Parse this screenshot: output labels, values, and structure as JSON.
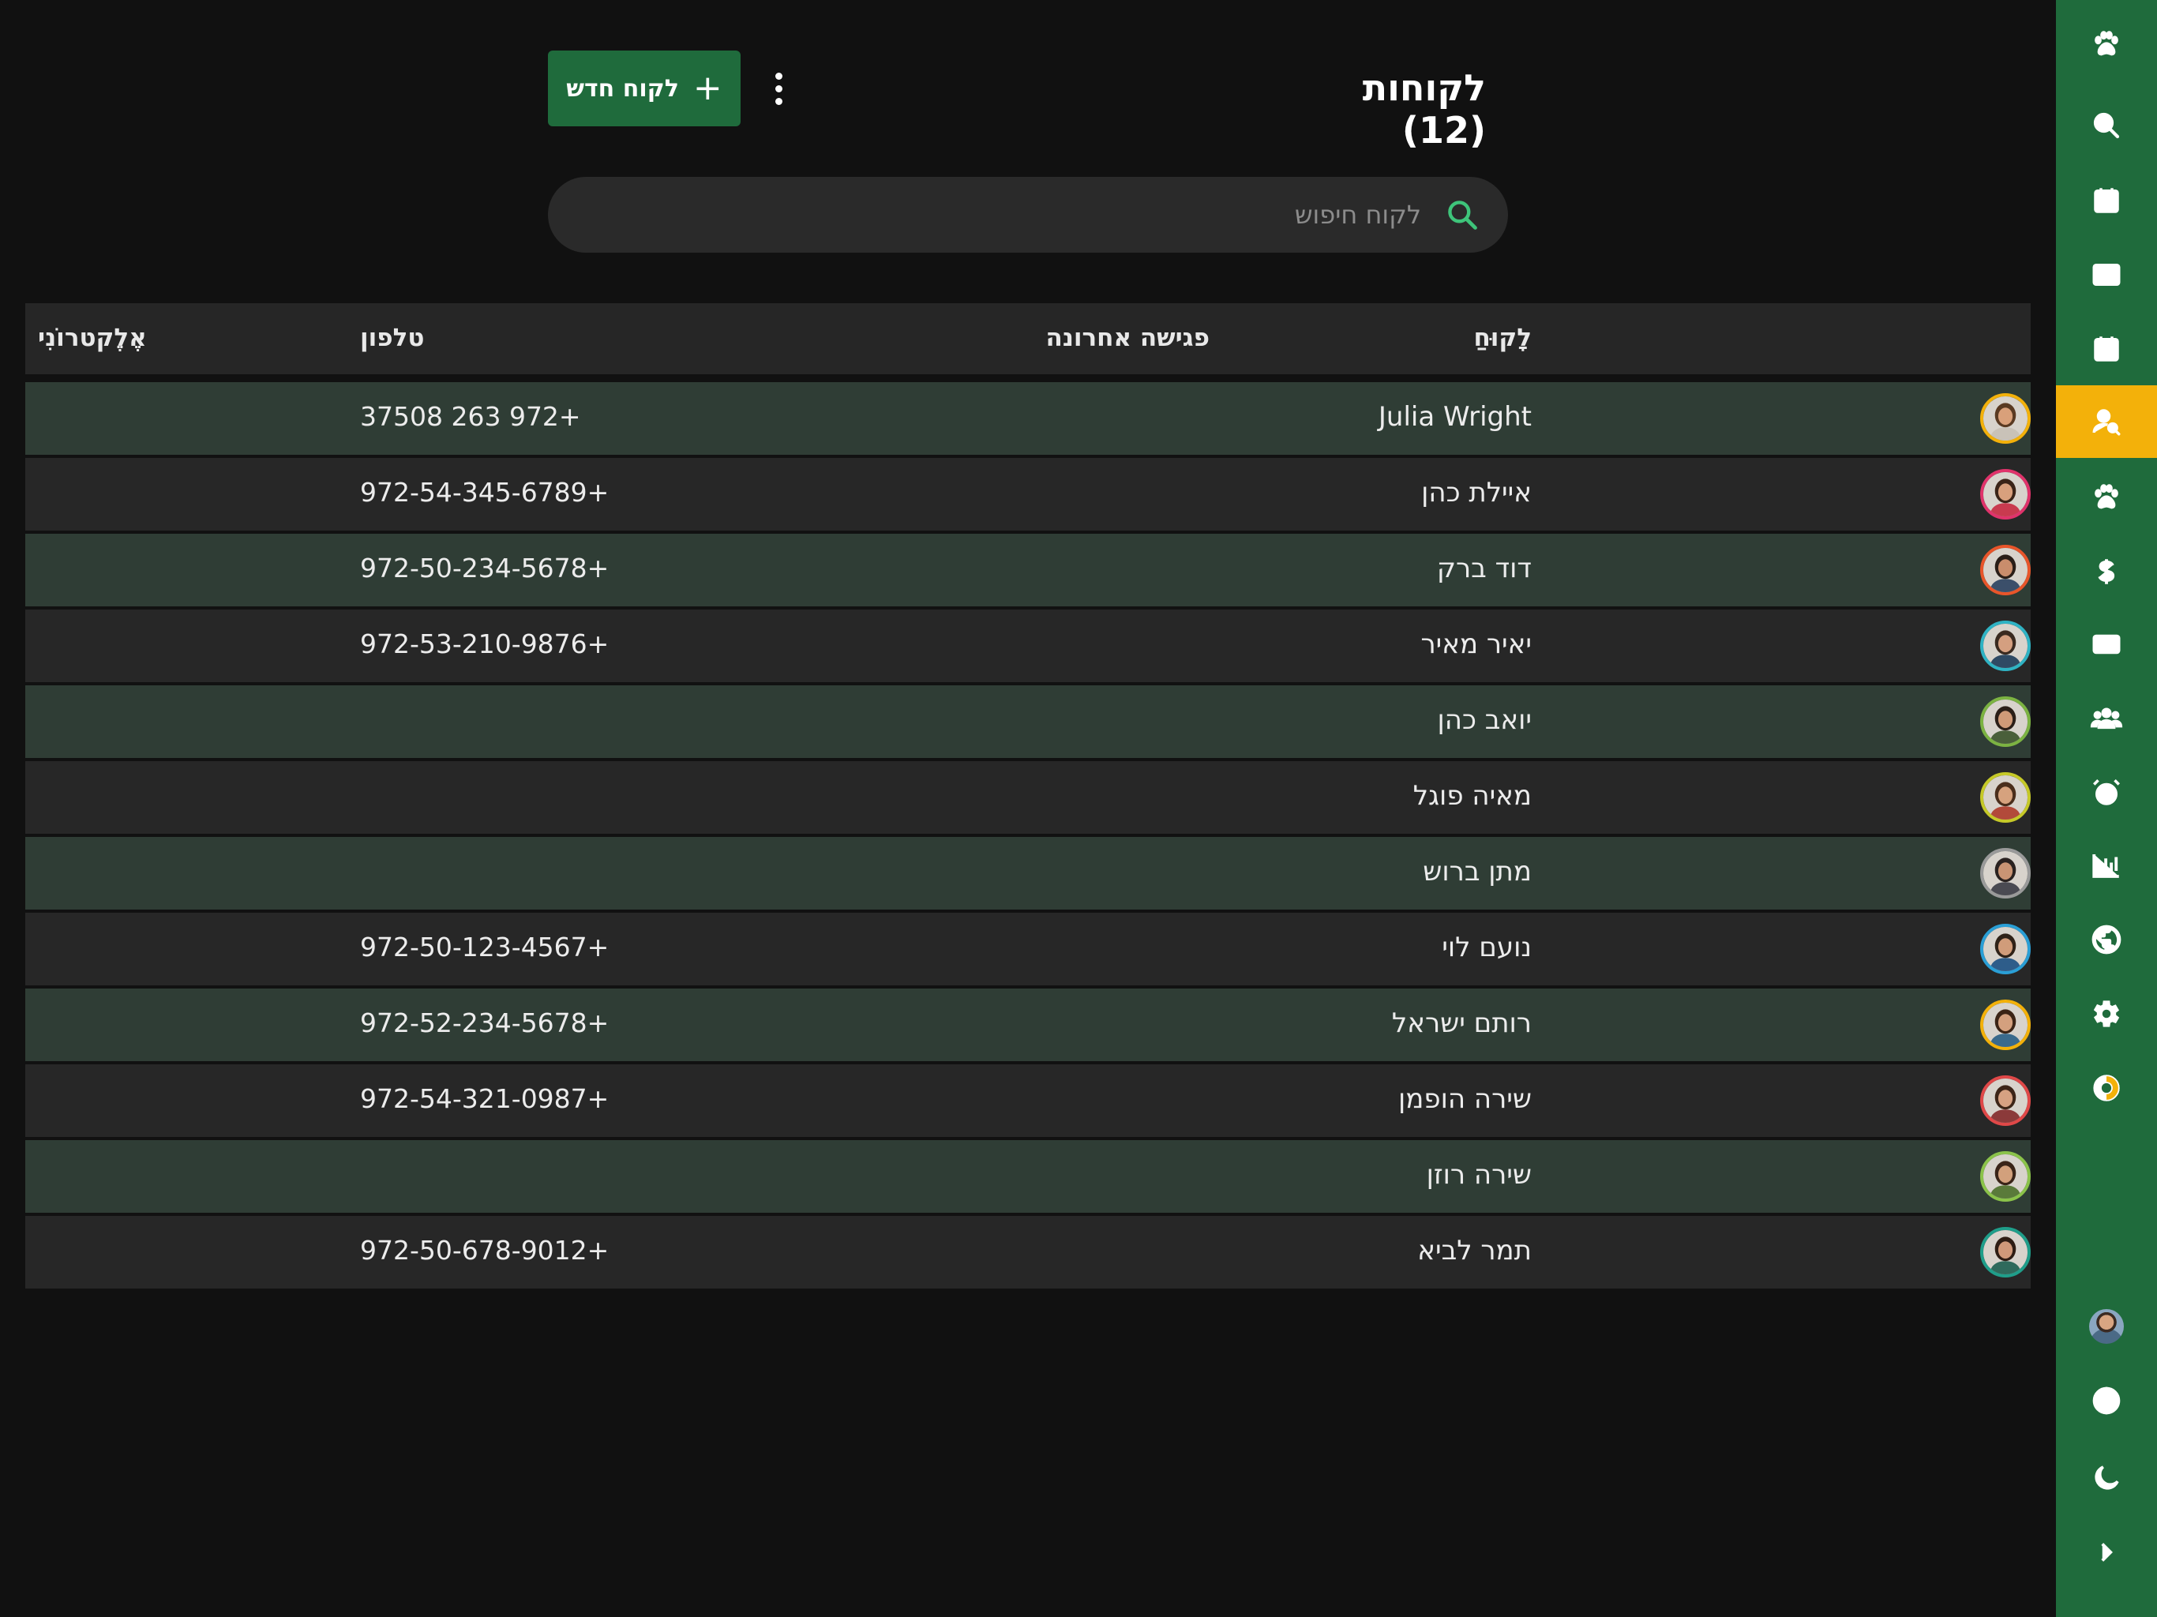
{
  "header": {
    "title": "לקוחות (12)",
    "new_button_label": "לקוח חדש",
    "plus_icon": "+"
  },
  "search": {
    "placeholder": "לקוח חיפוש"
  },
  "table": {
    "columns": {
      "customer": "לָקוּחַ",
      "last_meeting": "פגישה אחרונה",
      "phone": "טלפון",
      "email": "אֶלֶקטרוֹנִי"
    },
    "rows": [
      {
        "name": "Julia Wright",
        "phone": "37508 263 972+",
        "avatar_color": "#f3b10a",
        "hair": "#5a3a22",
        "skin": "#d9a07a",
        "shirt": "#c9c2b8"
      },
      {
        "name": "איילת כהן",
        "phone": "972-54-345-6789+",
        "avatar_color": "#e0336b",
        "hair": "#3a2418",
        "skin": "#d8a07d",
        "shirt": "#c93a4f"
      },
      {
        "name": "דוד ברק",
        "phone": "972-50-234-5678+",
        "avatar_color": "#e8552a",
        "hair": "#2a1e18",
        "skin": "#c98d6c",
        "shirt": "#3b4f6a"
      },
      {
        "name": "יאיר מאיר",
        "phone": "972-53-210-9876+",
        "avatar_color": "#2fb3c4",
        "hair": "#3a2a20",
        "skin": "#d49f80",
        "shirt": "#2f4a64"
      },
      {
        "name": "יואב כהן",
        "phone": "",
        "avatar_color": "#7cb342",
        "hair": "#2b1f18",
        "skin": "#cf9a78",
        "shirt": "#4a5f3a"
      },
      {
        "name": "מאיה פוגל",
        "phone": "",
        "avatar_color": "#c6c928",
        "hair": "#4a2e1c",
        "skin": "#d6a27e",
        "shirt": "#b24a3a"
      },
      {
        "name": "מתן ברוש",
        "phone": "",
        "avatar_color": "#9a9a9a",
        "hair": "#2a2220",
        "skin": "#c99474",
        "shirt": "#4a4a52"
      },
      {
        "name": "נועם לוי",
        "phone": "972-50-123-4567+",
        "avatar_color": "#2a9fd6",
        "hair": "#2f2218",
        "skin": "#d09c7a",
        "shirt": "#2e5d8a"
      },
      {
        "name": "רותם ישראל",
        "phone": "972-52-234-5678+",
        "avatar_color": "#f3b10a",
        "hair": "#3b2416",
        "skin": "#d4a07e",
        "shirt": "#3a6a8c"
      },
      {
        "name": "שירה הופמן",
        "phone": "972-54-321-0987+",
        "avatar_color": "#e04848",
        "hair": "#3d2518",
        "skin": "#d6a182",
        "shirt": "#8b3a3a"
      },
      {
        "name": "שירה רוזן",
        "phone": "",
        "avatar_color": "#8bc34a",
        "hair": "#3a2418",
        "skin": "#d2a07c",
        "shirt": "#5a7a3a"
      },
      {
        "name": "תמר לביא",
        "phone": "972-50-678-9012+",
        "avatar_color": "#1f9e8a",
        "hair": "#2e1d14",
        "skin": "#d0997a",
        "shirt": "#2f6a5c"
      }
    ]
  },
  "sidebar": {
    "active_index": 5,
    "items": [
      "paw-icon",
      "search-icon",
      "calendar-grid-icon",
      "columns-icon",
      "calendar-event-icon",
      "customer-search-icon",
      "paw-icon",
      "dollar-icon",
      "cash-icon",
      "group-icon",
      "alarm-icon",
      "bar-chart-icon",
      "globe-icon",
      "gear-icon",
      "donut-icon"
    ],
    "bottom": [
      "user-avatar",
      "language-globe-icon",
      "moon-icon",
      "chevron-right-icon"
    ],
    "accent_color": "#f3b10a",
    "bg_color": "#1f6b3c"
  }
}
